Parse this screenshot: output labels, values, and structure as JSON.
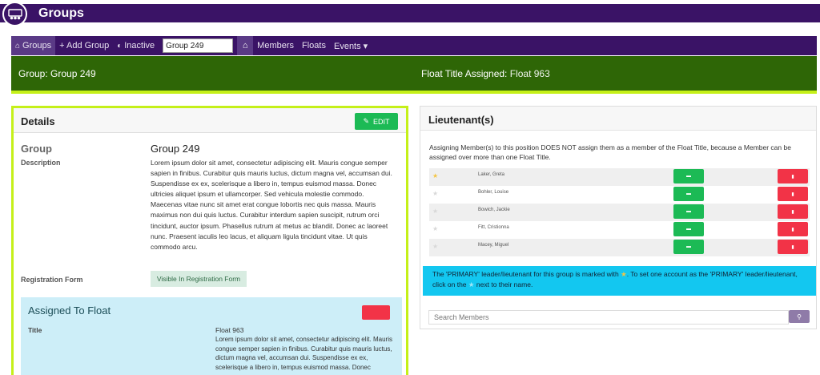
{
  "app": {
    "title": "Groups"
  },
  "nav": {
    "items": [
      {
        "label": "Groups",
        "icon": "home-icon",
        "active": true
      },
      {
        "label": "+ Add Group",
        "icon": "plus-icon"
      },
      {
        "label": "Inactive",
        "icon": "toggle-icon"
      }
    ],
    "search_value": "Group 249",
    "group_links": [
      {
        "label": "Members"
      },
      {
        "label": "Floats"
      },
      {
        "label": "Events ▾"
      }
    ]
  },
  "banner": {
    "group_text": "Group: Group 249",
    "float_label": "Float Title Assigned:",
    "float_value": "Float 963"
  },
  "details": {
    "heading": "Details",
    "edit_label": "EDIT",
    "group_label": "Group",
    "group_value": "Group 249",
    "description_label": "Description",
    "description": "Lorem ipsum dolor sit amet, consectetur adipiscing elit. Mauris congue semper sapien in finibus. Curabitur quis mauris luctus, dictum magna vel, accumsan dui. Suspendisse ex ex, scelerisque a libero in, tempus euismod massa. Donec ultricies aliquet ipsum et ullamcorper. Sed vehicula molestie commodo. Maecenas vitae nunc sit amet erat congue lobortis nec quis massa. Mauris maximus non dui quis luctus. Curabitur interdum sapien suscipit, rutrum orci tincidunt, auctor ipsum. Phasellus rutrum at metus ac blandit. Donec ac laoreet nunc. Praesent iaculis leo lacus, et aliquam ligula tincidunt vitae. Ut quis commodo arcu.",
    "registration_label": "Registration Form",
    "registration_value": "Visible In Registration Form",
    "assigned": {
      "heading": "Assigned To Float",
      "title_label": "Title",
      "title_value": "Float 963",
      "title_description": "Lorem ipsum dolor sit amet, consectetur adipiscing elit. Mauris congue semper sapien in finibus. Curabitur quis mauris luctus, dictum magna vel, accumsan dui. Suspendisse ex ex, scelerisque a libero in, tempus euismod massa. Donec"
    }
  },
  "lieutenants": {
    "heading": "Lieutenant(s)",
    "note": "Assigning Member(s) to this position DOES NOT assign them as a member of the Float Title, because a Member can be assigned over more than one Float Title.",
    "rows": [
      {
        "name": "Laker, Greta",
        "primary": true
      },
      {
        "name": "Bohler, Louise",
        "primary": false
      },
      {
        "name": "Bowich, Jackie",
        "primary": false
      },
      {
        "name": "Fitt, Cristionna",
        "primary": false
      },
      {
        "name": "Macey, Miguel",
        "primary": false
      }
    ],
    "info_part1": "The 'PRIMARY' leader/lieutenant for this group is marked with",
    "info_part2": ". To set one account as the 'PRIMARY' leader/lieutenant, click on the",
    "info_part3": "next to their name.",
    "search_placeholder": "Search Members"
  },
  "colors": {
    "nav_purple": "#3a1366",
    "banner_green": "#2e6606",
    "accent_lime": "#c5f019",
    "button_green": "#1cba55",
    "button_red": "#f23347",
    "info_cyan": "#13c7f0"
  }
}
